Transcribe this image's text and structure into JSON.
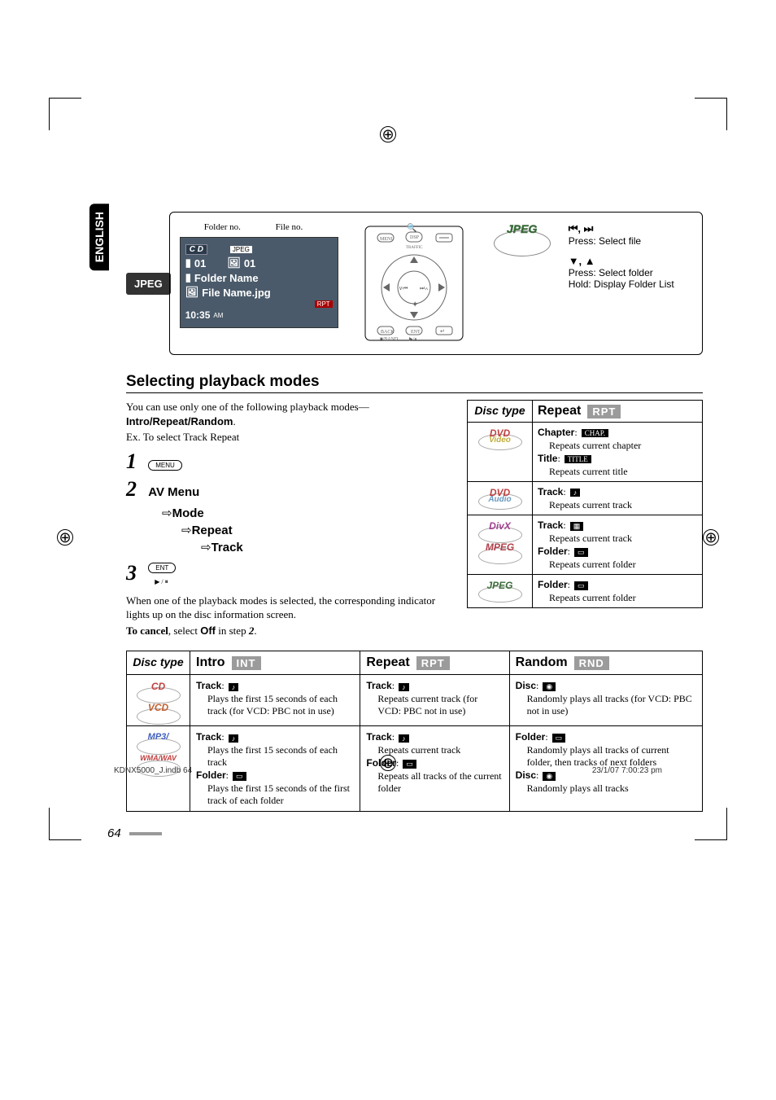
{
  "language_tab": "ENGLISH",
  "jpeg_box": {
    "title": "JPEG",
    "lcd_labels": {
      "folder": "Folder no.",
      "file": "File no."
    },
    "lcd": {
      "source": "C D",
      "format": "JPEG",
      "folder_no": "01",
      "file_no": "01",
      "folder_name": "Folder Name",
      "file_name": "File Name.jpg",
      "rpt": "RPT",
      "time": "10:35",
      "ampm": "AM"
    },
    "disc_label": "JPEG",
    "controls": {
      "prev_next_glyphs": "⏮, ⏭",
      "prev_next_desc": "Press: Select file",
      "updown_glyphs": "▼, ▲",
      "updown_desc1": "Press: Select folder",
      "updown_desc2": "Hold: Display Folder List"
    }
  },
  "section_heading": "Selecting playback modes",
  "intro_para": {
    "line1": "You can use only one of the following playback modes—",
    "modes": "Intro/Repeat/Random",
    "period": ".",
    "example": "Ex. To select Track Repeat"
  },
  "steps": {
    "s1_btn": "MENU",
    "s2_menu": {
      "l1": "AV Menu",
      "l2": "Mode",
      "l3": "Repeat",
      "l4": "Track",
      "arrow": "⇨"
    },
    "s3_btn_top": "ENT",
    "s3_btn_bot": "▶ / ⏸"
  },
  "after_steps": {
    "p1": "When one of the playback modes is selected, the corresponding indicator lights up on the disc information screen.",
    "cancel_pre": "To cancel",
    "cancel_mid": ", select ",
    "cancel_off": "Off",
    "cancel_post": " in step ",
    "cancel_step": "2",
    "cancel_end": "."
  },
  "repeat_table": {
    "header_disc": "Disc type",
    "header_mode": "Repeat",
    "header_tag": "RPT",
    "rows": [
      {
        "discs": [
          "DVD|Video|dvd-video"
        ],
        "items": [
          {
            "name": "Chapter",
            "icon": "CHAP.",
            "desc": "Repeats current chapter"
          },
          {
            "name": "Title",
            "icon": "TITLE",
            "desc": "Repeats current title"
          }
        ]
      },
      {
        "discs": [
          "DVD|Audio|dvd-audio"
        ],
        "items": [
          {
            "name": "Track",
            "icon": "♪",
            "desc": "Repeats current track"
          }
        ]
      },
      {
        "discs": [
          "DivX||divx",
          "MPEG||mpeg"
        ],
        "items": [
          {
            "name": "Track",
            "icon": "▦",
            "desc": "Repeats current track"
          },
          {
            "name": "Folder",
            "icon": "▭",
            "desc": "Repeats current folder"
          }
        ]
      },
      {
        "discs": [
          "JPEG||jpeg-s"
        ],
        "items": [
          {
            "name": "Folder",
            "icon": "▭",
            "desc": "Repeats current folder"
          }
        ]
      }
    ]
  },
  "big_table": {
    "header_disc": "Disc type",
    "cols": [
      {
        "title": "Intro",
        "tag": "INT"
      },
      {
        "title": "Repeat",
        "tag": "RPT"
      },
      {
        "title": "Random",
        "tag": "RND"
      }
    ],
    "rows": [
      {
        "discs": [
          "CD||cd-s",
          "VCD||vcd"
        ],
        "cells": [
          [
            {
              "name": "Track",
              "icon": "♪",
              "desc": "Plays the first 15 seconds of each track (for VCD: PBC not in use)"
            }
          ],
          [
            {
              "name": "Track",
              "icon": "♪",
              "desc": "Repeats current track (for VCD: PBC not in use)"
            }
          ],
          [
            {
              "name": "Disc",
              "icon": "◉",
              "desc": "Randomly plays all tracks (for VCD: PBC not in use)"
            }
          ]
        ]
      },
      {
        "discs": [
          "MP3/||mp3",
          "WMA/WAV||wma"
        ],
        "cells": [
          [
            {
              "name": "Track",
              "icon": "♪",
              "desc": "Plays the first 15 seconds of each track"
            },
            {
              "name": "Folder",
              "icon": "▭",
              "desc": "Plays the first 15 seconds of the first track of each folder"
            }
          ],
          [
            {
              "name": "Track",
              "icon": "♪",
              "desc": "Repeats current track"
            },
            {
              "name": "Folder",
              "icon": "▭",
              "desc": "Repeats all tracks of the current folder"
            }
          ],
          [
            {
              "name": "Folder",
              "icon": "▭",
              "desc": "Randomly plays all tracks of current folder, then tracks of next folders"
            },
            {
              "name": "Disc",
              "icon": "◉",
              "desc": "Randomly plays all tracks"
            }
          ]
        ]
      }
    ]
  },
  "page_number": "64",
  "footer": {
    "left": "KDNX5000_J.indb   64",
    "right": "23/1/07   7:00:23 pm"
  }
}
